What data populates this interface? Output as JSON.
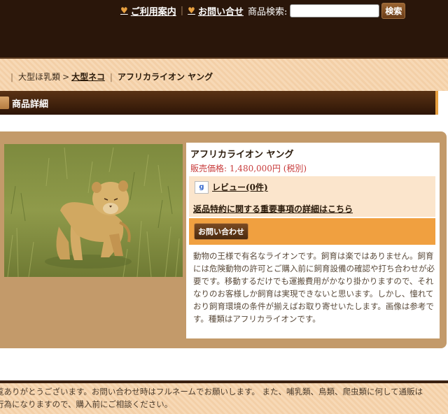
{
  "header": {
    "nav": [
      {
        "label": "ご利用案内"
      },
      {
        "label": "お問い合せ"
      }
    ],
    "search": {
      "label": "商品検索:",
      "placeholder": "",
      "button": "検索"
    }
  },
  "breadcrumb": {
    "items": [
      "大型ほ乳類",
      "大型ネコ"
    ],
    "separator": ">",
    "current": "アフリカライオン ヤング"
  },
  "section": {
    "title": "商品詳細"
  },
  "product": {
    "name": "アフリカライオン ヤング",
    "price_label": "販売価格: 1,480,000円 (税別)",
    "review_icon": "g",
    "review_label": "レビュー(0件)",
    "return_policy": "返品特約に関する重要事項の詳細はこちら",
    "inquiry_button": "お問い合わせ",
    "description": "動物の王様で有名なライオンです。飼育は楽ではありません。飼育には危険動物の許可とご購入前に飼育設備の確認や打ち合わせが必要です。移動するだけでも運搬費用がかなり掛かりますので、それなりのお客様しか飼育は実現できないと思います。しかし、憧れており飼育環境の条件が揃えばお取り寄せいたします。画像は参考です。種類はアフリカライオンです。",
    "image_alt_icon": "lion-cub-photo"
  },
  "footer": {
    "line1": "覧ありがとうございます。お問い合わせ時はフルネームでお願いします。 また、哺乳類、鳥類、爬虫類に何して通販は",
    "line2": "行為になりますので、購入前にご相談ください。"
  },
  "colors": {
    "header_bg": "#2a160a",
    "accent": "#e8a040",
    "panel": "#c39a6a",
    "price": "#c83c3c"
  }
}
